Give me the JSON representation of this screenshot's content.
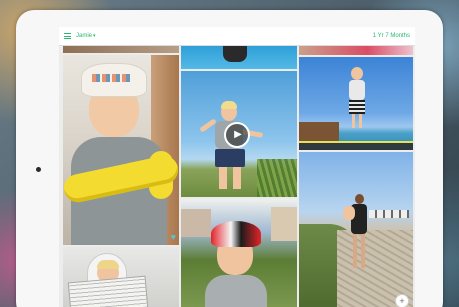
{
  "app": {
    "child_name": "Jamie",
    "child_age": "1 Yr 7 Months",
    "accent_color": "#2bb673"
  },
  "icons": {
    "menu": "hamburger-menu-icon",
    "dropdown": "chevron-down-icon",
    "play": "play-icon",
    "favorite": "heart-icon",
    "add": "plus-icon"
  },
  "glyphs": {
    "caret": "▾",
    "play": "▶",
    "heart": "♥",
    "plus": "+"
  },
  "gallery": {
    "photos": [
      {
        "name": "photo-boy-white-hat",
        "kind": "photo",
        "favorite": true
      },
      {
        "name": "photo-pool",
        "kind": "photo"
      },
      {
        "name": "photo-video-lawn",
        "kind": "video"
      },
      {
        "name": "photo-trampoline",
        "kind": "photo"
      },
      {
        "name": "photo-mother-baby",
        "kind": "photo"
      },
      {
        "name": "photo-bike-helmet",
        "kind": "photo"
      },
      {
        "name": "photo-newspaper",
        "kind": "photo"
      }
    ]
  }
}
